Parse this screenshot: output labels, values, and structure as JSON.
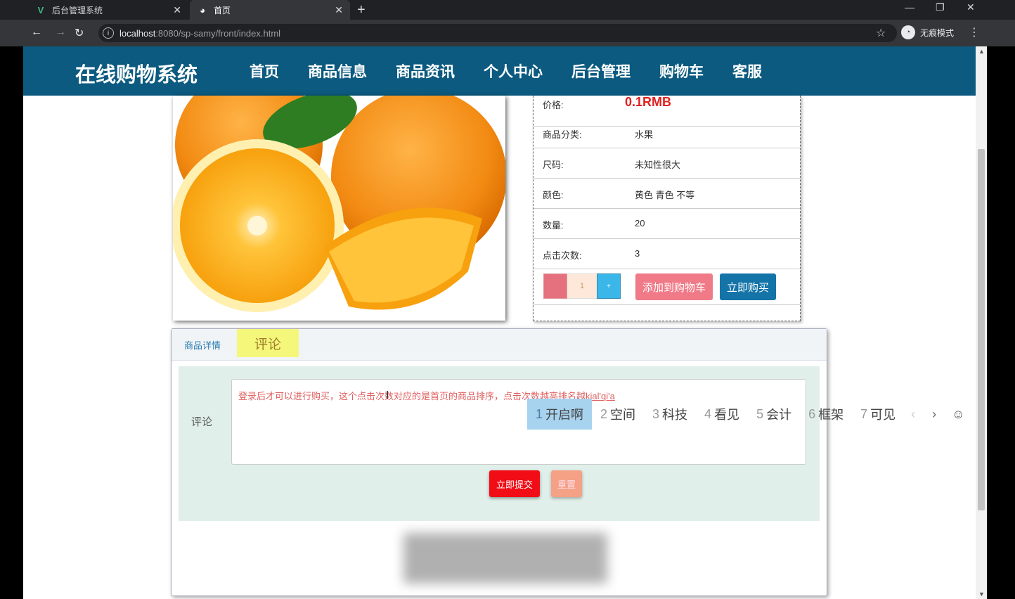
{
  "browser": {
    "tabs": [
      {
        "title": "后台管理系统",
        "icon": "vue-icon"
      },
      {
        "title": "首页",
        "icon": "globe-icon"
      }
    ],
    "url_host": "localhost",
    "url_path": ":8080/sp-samy/front/index.html",
    "incognito_label": "无痕模式"
  },
  "header": {
    "brand": "在线购物系统",
    "menu": [
      "首页",
      "商品信息",
      "商品资讯",
      "个人中心",
      "后台管理",
      "购物车",
      "客服"
    ]
  },
  "product": {
    "price_label": "价格:",
    "price_value": "0.1RMB",
    "rows": [
      {
        "label": "商品分类:",
        "value": "水果"
      },
      {
        "label": "尺码:",
        "value": "未知性很大"
      },
      {
        "label": "颜色:",
        "value": "黄色 青色 不等"
      },
      {
        "label": "数量:",
        "value": "20"
      },
      {
        "label": "点击次数:",
        "value": "3"
      }
    ],
    "quantity": "1",
    "minus_label": "-",
    "plus_label": "+",
    "add_cart_label": "添加到购物车",
    "buy_now_label": "立即购买"
  },
  "detail": {
    "tabs": [
      "商品详情",
      "评论"
    ],
    "comment_label": "评论",
    "comment_text": "登录后才可以进行购买，这个点击次数对应的是首页的商品排序，点击次数越高排名越",
    "comment_pinyin": "kial'qi'a",
    "submit_label": "立即提交",
    "reset_label": "重置"
  },
  "ime": {
    "candidates": [
      {
        "n": "1",
        "w": "开启啊"
      },
      {
        "n": "2",
        "w": "空间"
      },
      {
        "n": "3",
        "w": "科技"
      },
      {
        "n": "4",
        "w": "看见"
      },
      {
        "n": "5",
        "w": "会计"
      },
      {
        "n": "6",
        "w": "框架"
      },
      {
        "n": "7",
        "w": "可见"
      }
    ],
    "prev": "‹",
    "next": "›",
    "emoji": "☺"
  }
}
